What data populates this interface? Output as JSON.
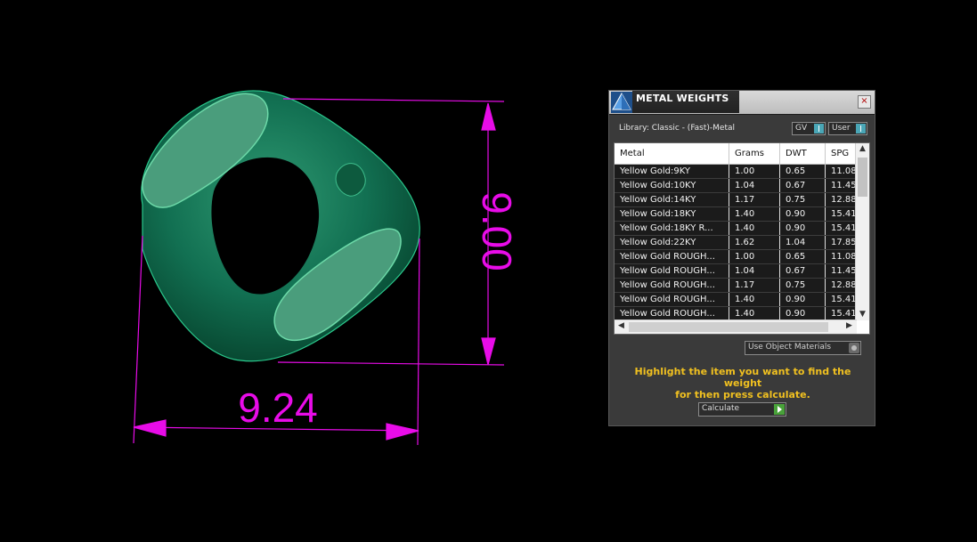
{
  "viewport": {
    "dimension_horizontal": "9.24",
    "dimension_vertical": "9.00",
    "model_color": "#0f6a48",
    "dimension_color": "#e80ce8"
  },
  "panel": {
    "title": "METAL WEIGHTS",
    "close_label": "×",
    "library_text": "Library: Classic - (Fast)-Metal",
    "toggle_gv_label": "GV",
    "toggle_user_label": "User",
    "columns": [
      "Metal",
      "Grams",
      "DWT",
      "SPG"
    ],
    "rows": [
      {
        "metal": "Yellow Gold:9KY",
        "grams": "1.00",
        "dwt": "0.65",
        "spg": "11.08"
      },
      {
        "metal": "Yellow Gold:10KY",
        "grams": "1.04",
        "dwt": "0.67",
        "spg": "11.45"
      },
      {
        "metal": "Yellow Gold:14KY",
        "grams": "1.17",
        "dwt": "0.75",
        "spg": "12.88"
      },
      {
        "metal": "Yellow Gold:18KY",
        "grams": "1.40",
        "dwt": "0.90",
        "spg": "15.41"
      },
      {
        "metal": "Yellow Gold:18KY R...",
        "grams": "1.40",
        "dwt": "0.90",
        "spg": "15.41"
      },
      {
        "metal": "Yellow Gold:22KY",
        "grams": "1.62",
        "dwt": "1.04",
        "spg": "17.85"
      },
      {
        "metal": "Yellow Gold ROUGH...",
        "grams": "1.00",
        "dwt": "0.65",
        "spg": "11.08"
      },
      {
        "metal": "Yellow Gold ROUGH...",
        "grams": "1.04",
        "dwt": "0.67",
        "spg": "11.45"
      },
      {
        "metal": "Yellow Gold ROUGH...",
        "grams": "1.17",
        "dwt": "0.75",
        "spg": "12.88"
      },
      {
        "metal": "Yellow Gold ROUGH...",
        "grams": "1.40",
        "dwt": "0.90",
        "spg": "15.41"
      },
      {
        "metal": "Yellow Gold ROUGH...",
        "grams": "1.40",
        "dwt": "0.90",
        "spg": "15.41"
      }
    ],
    "use_object_materials_label": "Use Object Materials",
    "hint_line1": "Highlight the item you want to find the weight",
    "hint_line2": "for then press calculate.",
    "calculate_label": "Calculate",
    "accent_color": "#f0c020"
  }
}
